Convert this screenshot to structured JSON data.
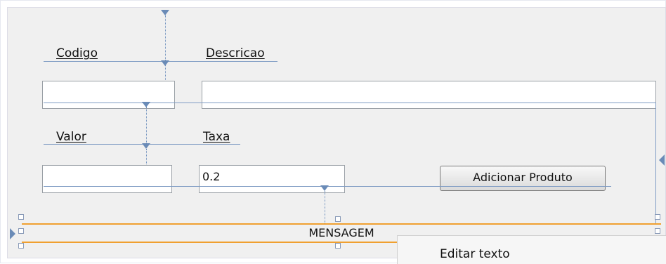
{
  "form": {
    "codigo_label": "Codigo",
    "descricao_label": "Descricao",
    "valor_label": "Valor",
    "taxa_label": "Taxa",
    "codigo_value": "",
    "descricao_value": "",
    "valor_value": "",
    "taxa_value": "0.2",
    "add_button_label": "Adicionar Produto",
    "message_label": "MENSAGEM"
  },
  "context_menu": {
    "items": [
      "Editar texto"
    ]
  },
  "colors": {
    "guide_line": "#7f9cc4",
    "selection_border": "#f0a030",
    "canvas_bg": "#f0f0f0"
  }
}
